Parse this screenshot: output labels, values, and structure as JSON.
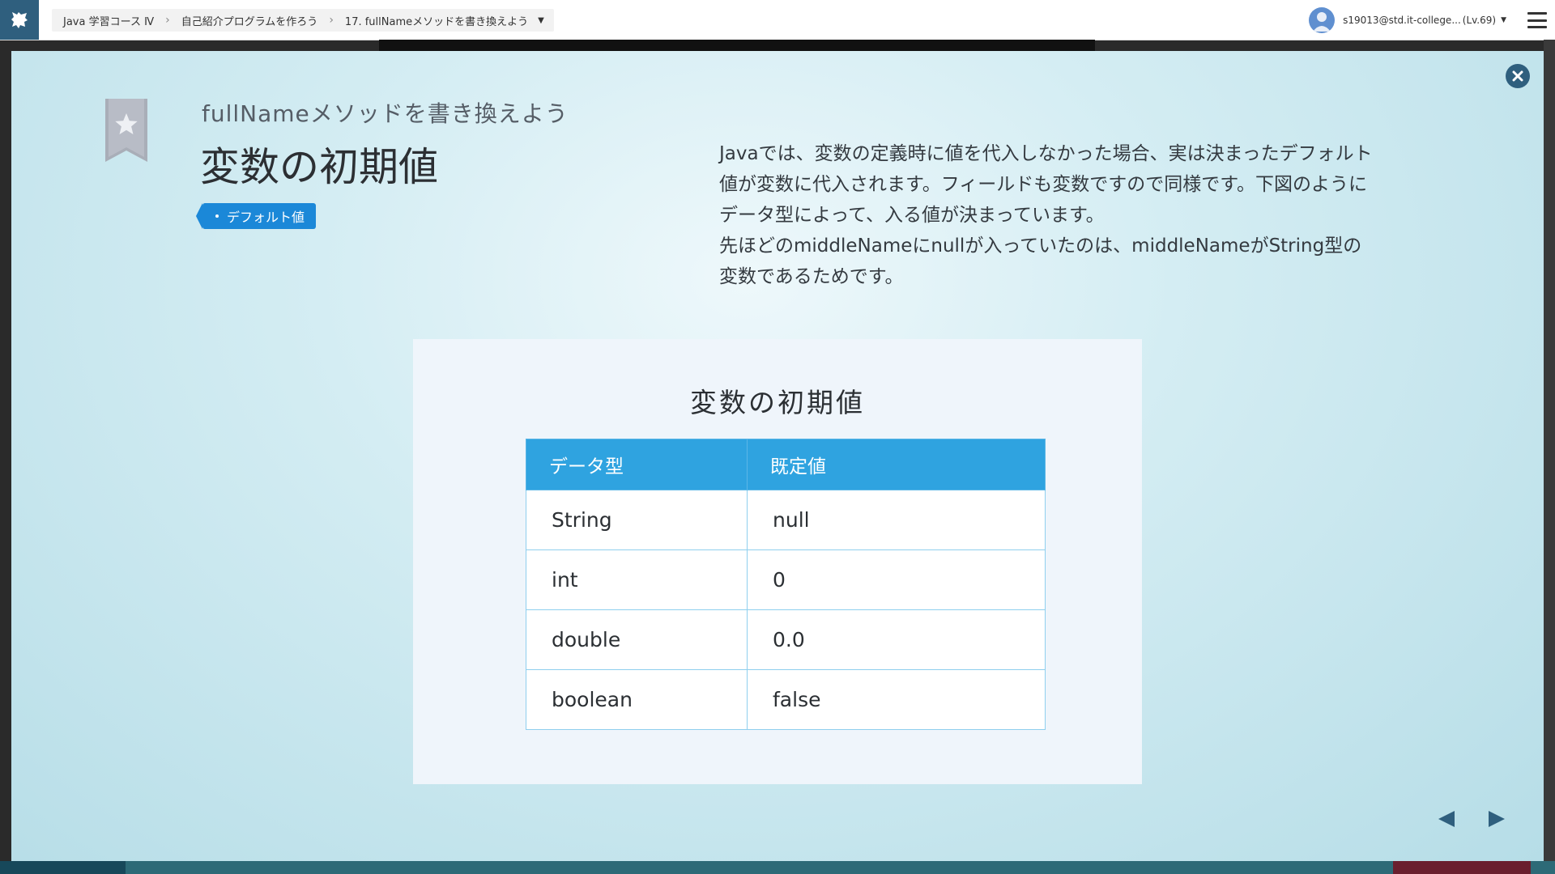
{
  "breadcrumb": {
    "course": "Java 学習コース Ⅳ",
    "chapter": "自己紹介プログラムを作ろう",
    "lesson": "17. fullNameメソッドを書き換えよう"
  },
  "user": {
    "name": "s19013@std.it-college...",
    "level": "(Lv.69)"
  },
  "slide": {
    "subtitle": "fullNameメソッドを書き換えよう",
    "title": "変数の初期値",
    "tag": "デフォルト値",
    "description": [
      "Javaでは、変数の定義時に値を代入しなかった場合、実は決まったデフォルト",
      "値が変数に代入されます。フィールドも変数ですので同様です。下図のように",
      "データ型によって、入る値が決まっています。",
      "先ほどのmiddleNameにnullが入っていたのは、middleNameがString型の",
      "変数であるためです。"
    ]
  },
  "card": {
    "title": "変数の初期値",
    "headers": [
      "データ型",
      "既定値"
    ],
    "rows": [
      [
        "String",
        "null"
      ],
      [
        "int",
        "0"
      ],
      [
        "double",
        "0.0"
      ],
      [
        "boolean",
        "false"
      ]
    ]
  },
  "colors": {
    "accent": "#2fa3e0",
    "tag": "#1b88d8",
    "dark_button": "#2f5f7e"
  },
  "icons": [
    "app-logo-icon",
    "chevron-right-icon",
    "caret-down-icon",
    "user-avatar-icon",
    "hamburger-menu-icon",
    "close-icon",
    "star-bookmark-icon",
    "prev-arrow-icon",
    "next-arrow-icon"
  ]
}
